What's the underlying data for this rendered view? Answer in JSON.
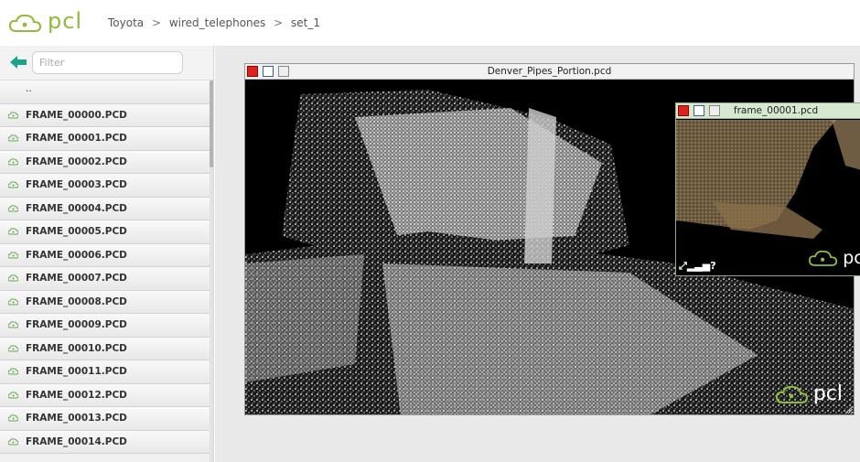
{
  "header": {
    "logo_text": "pcl",
    "breadcrumb": [
      "Toyota",
      "wired_telephones",
      "set_1"
    ],
    "separator": ">"
  },
  "sidebar": {
    "filter_placeholder": "Filter",
    "parent_label": "..",
    "files": [
      "FRAME_00000.PCD",
      "FRAME_00001.PCD",
      "FRAME_00002.PCD",
      "FRAME_00003.PCD",
      "FRAME_00004.PCD",
      "FRAME_00005.PCD",
      "FRAME_00006.PCD",
      "FRAME_00007.PCD",
      "FRAME_00008.PCD",
      "FRAME_00009.PCD",
      "FRAME_00010.PCD",
      "FRAME_00011.PCD",
      "FRAME_00012.PCD",
      "FRAME_00013.PCD",
      "FRAME_00014.PCD"
    ]
  },
  "viewer_main": {
    "title": "Denver_Pipes_Portion.pcd",
    "watermark": "pcl"
  },
  "viewer_small": {
    "title": "frame_00001.pcd",
    "watermark": "pcl",
    "status_glyph": "?"
  },
  "colors": {
    "brand_green": "#8dbb3c",
    "sidebar_bg": "#f0f0f0",
    "small_titlebar": "#d6e8cf"
  }
}
